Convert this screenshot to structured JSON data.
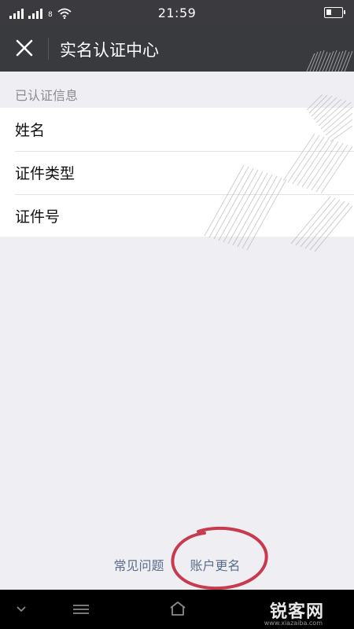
{
  "status_bar": {
    "time": "21:59",
    "sim_label": "8"
  },
  "nav": {
    "title": "实名认证中心"
  },
  "section": {
    "header": "已认证信息"
  },
  "info_items": [
    {
      "label": "姓名"
    },
    {
      "label": "证件类型"
    },
    {
      "label": "证件号"
    }
  ],
  "footer": {
    "faq_label": "常见问题",
    "rename_label": "账户更名"
  },
  "watermark": {
    "text": "锐客网",
    "url": "www.xiazaiba.com"
  },
  "colors": {
    "status_bar_bg": "#3a3a3f",
    "nav_bg": "#393a3e",
    "page_bg": "#efeef3",
    "link": "#5a6e8c",
    "annotation_circle": "#c83a4e"
  }
}
